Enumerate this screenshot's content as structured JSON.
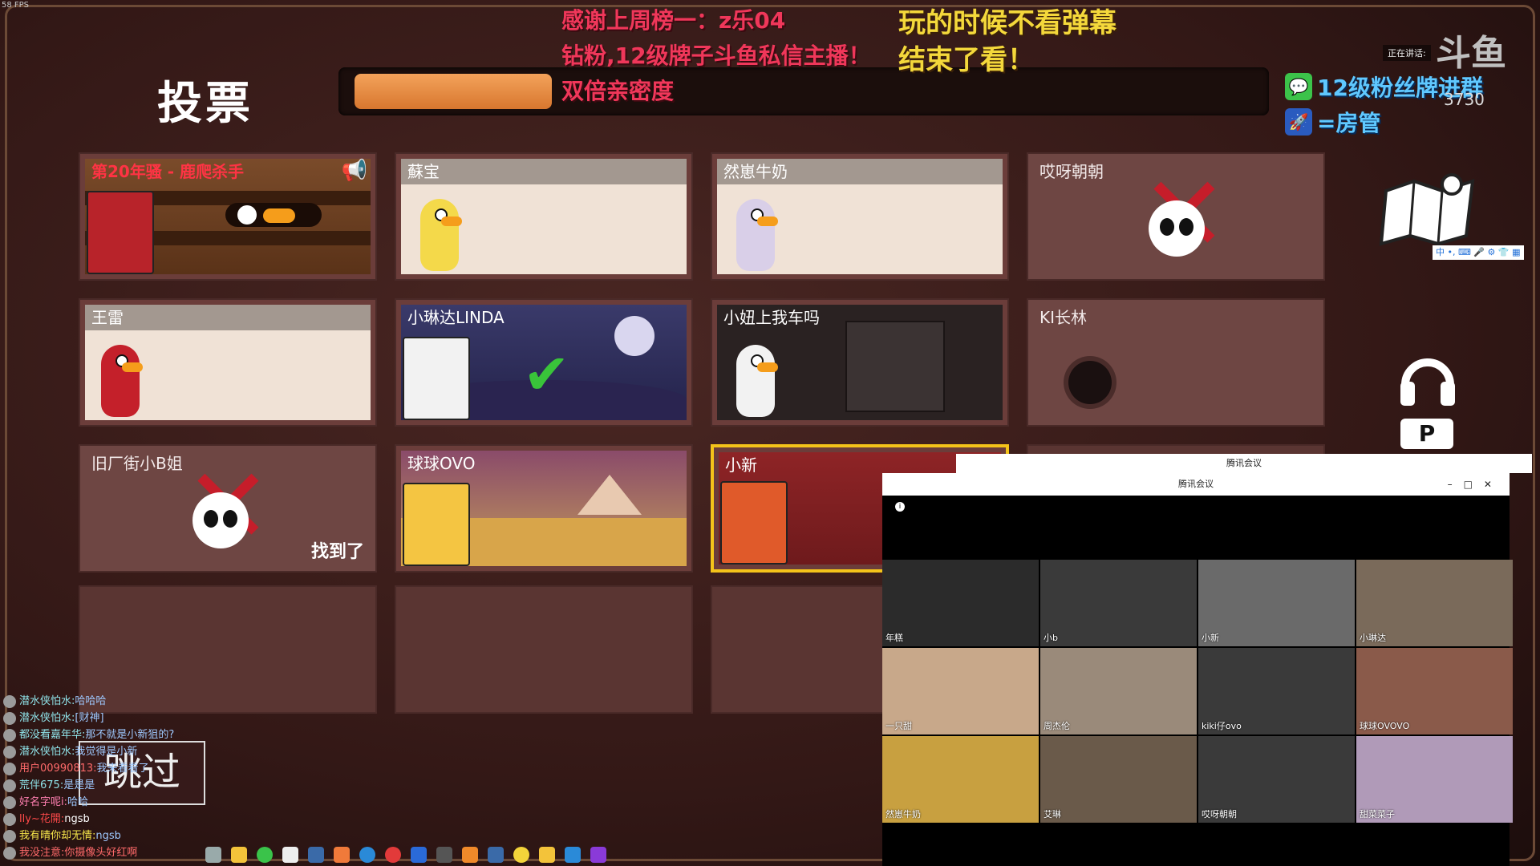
{
  "fps": "58 FPS",
  "screen_title": "投票",
  "vote_progress_fraction": 0.22,
  "overlay_red": [
    "感谢上周榜一：z乐04",
    "钻粉,12级牌子斗鱼私信主播！",
    "双倍亲密度"
  ],
  "overlay_yellow": [
    "玩的时候不看弹幕",
    "结束了看！"
  ],
  "players": [
    {
      "name": "第20年骚 - 鹿爬杀手",
      "style": "red-fence"
    },
    {
      "name": "蘇宝",
      "style": "light"
    },
    {
      "name": "然崽牛奶",
      "style": "light"
    },
    {
      "name": "哎呀朝朝",
      "style": "dead"
    },
    {
      "name": "王雷",
      "style": "light"
    },
    {
      "name": "小琳达LINDA",
      "style": "night-check"
    },
    {
      "name": "小妞上我车吗",
      "style": "dark-room"
    },
    {
      "name": "KI长林",
      "style": "dead-hole"
    },
    {
      "name": "旧厂街小B姐",
      "style": "dead",
      "extra": "找到了"
    },
    {
      "name": "球球OVO",
      "style": "desert"
    },
    {
      "name": "小新",
      "style": "selected"
    }
  ],
  "skip_label": "跳过",
  "chat": [
    {
      "user": "潜水侠怕水:",
      "msg": "哈哈哈"
    },
    {
      "user": "潜水侠怕水:",
      "msg": "[财神]"
    },
    {
      "user": "都没看嘉年华:",
      "msg": "那不就是小新狙的?"
    },
    {
      "user": "潜水侠怕水:",
      "msg": "我觉得是小新"
    },
    {
      "user": "用户00990813:",
      "msg": "我来看看了"
    },
    {
      "user": "荒伴675:",
      "msg": "是是是"
    },
    {
      "user": "好名字呢i:",
      "msg": "哈哈"
    },
    {
      "user": "lly~花開:",
      "msg": "ngsb"
    },
    {
      "user": "我有晴你却无情:",
      "msg": "ngsb"
    },
    {
      "user": "我没注意:",
      "msg": "你摄像头好红啊"
    }
  ],
  "wechat_text": "12级粉丝牌进群",
  "fangguan_text": "=房管",
  "speaking_label": "正在讲话:",
  "room_number": "3730",
  "douyu_text": "斗鱼",
  "ime_text": "中 •, ⌨ 🎤 ⚙ 👕 ▦",
  "meeting_title": "腾讯会议",
  "meeting_title_back": "腾讯会议",
  "participants": [
    "年糕",
    "小b",
    "小新",
    "小琳达",
    "一只甜",
    "周杰伦",
    "kiki仔ovo",
    "球球OVOVO",
    "然崽牛奶",
    "艾琳",
    "哎呀朝朝",
    "甜菜菜子"
  ],
  "colors": {
    "accent_orange": "#e8883a",
    "selected_border": "#f4c31a",
    "kill_x": "#c61d2a"
  }
}
